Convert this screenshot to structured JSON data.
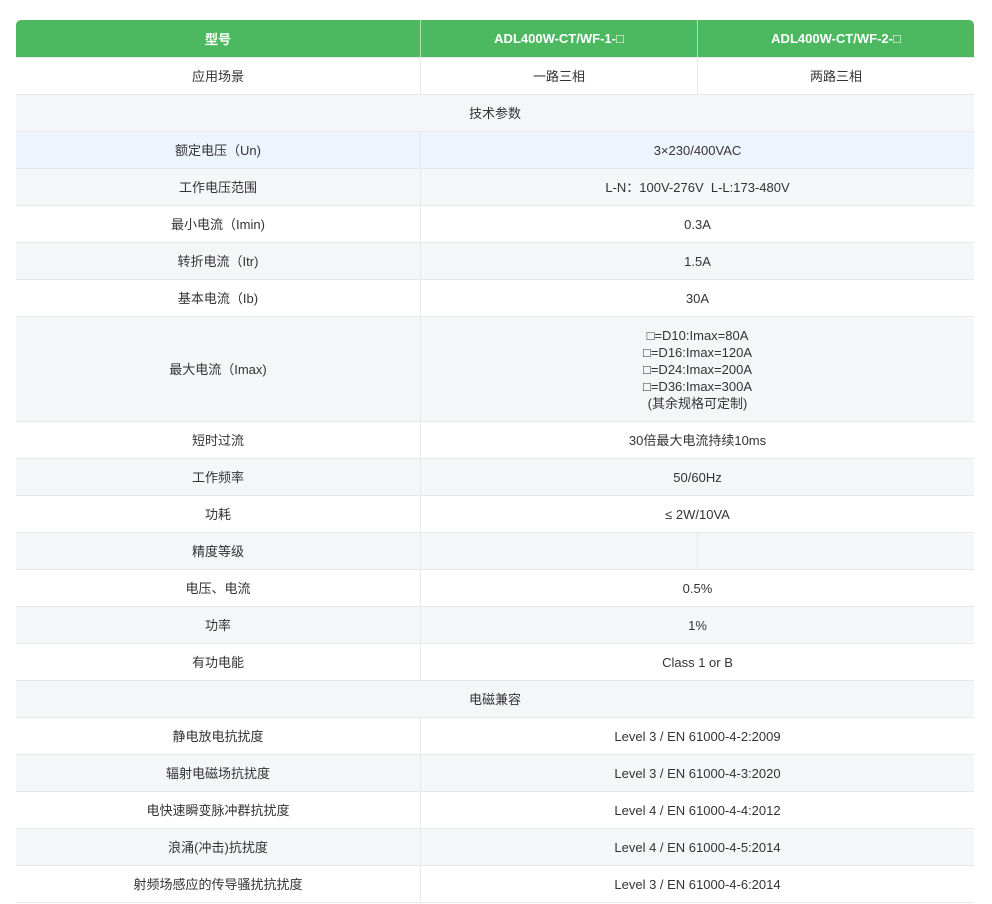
{
  "header": {
    "col1": "型号",
    "col2": "ADL400W-CT/WF-1-□",
    "col3": "ADL400W-CT/WF-2-□"
  },
  "rows": {
    "application": {
      "label": "应用场景",
      "v1": "一路三相",
      "v2": "两路三相"
    },
    "tech_section": "技术参数",
    "rated_voltage": {
      "label": "额定电压（Un)",
      "value": "3×230/400VAC"
    },
    "working_voltage": {
      "label": "工作电压范围",
      "value": "L-N：100V-276V  L-L:173-480V"
    },
    "min_current": {
      "label": "最小电流（Imin)",
      "value": "0.3A"
    },
    "transition_current": {
      "label": "转折电流（Itr)",
      "value": "1.5A"
    },
    "basic_current": {
      "label": "基本电流（Ib)",
      "value": "30A"
    },
    "max_current": {
      "label": "最大电流（Imax)",
      "lines": [
        "□=D10:Imax=80A",
        "□=D16:Imax=120A",
        "□=D24:Imax=200A",
        "□=D36:Imax=300A",
        "(其余规格可定制)"
      ]
    },
    "short_overcurrent": {
      "label": "短时过流",
      "value": "30倍最大电流持续10ms"
    },
    "frequency": {
      "label": "工作频率",
      "value": "50/60Hz"
    },
    "power_consumption": {
      "label": "功耗",
      "value": "≤ 2W/10VA"
    },
    "accuracy": {
      "label": "精度等级"
    },
    "voltage_current": {
      "label": "电压、电流",
      "value": "0.5%"
    },
    "power": {
      "label": "功率",
      "value": "1%"
    },
    "active_energy": {
      "label": "有功电能",
      "value": "Class 1 or B"
    },
    "emc_section": "电磁兼容",
    "esd": {
      "label": "静电放电抗扰度",
      "value": "Level 3 / EN 61000-4-2:2009"
    },
    "radiated": {
      "label": "辐射电磁场抗扰度",
      "value": "Level 3 / EN 61000-4-3:2020"
    },
    "eft": {
      "label": "电快速瞬变脉冲群抗扰度",
      "value": "Level 4 / EN 61000-4-4:2012"
    },
    "surge": {
      "label": "浪涌(冲击)抗扰度",
      "value": "Level 4 / EN 61000-4-5:2014"
    },
    "conducted": {
      "label": "射频场感应的传导骚扰抗扰度",
      "value": "Level 3 / EN 61000-4-6:2014"
    }
  },
  "colors": {
    "header_bg": "#4cb85f",
    "row_alt_bg": "#f5f6f8",
    "row_highlight_bg": "#eef4fd",
    "border": "#e6e8ec"
  }
}
